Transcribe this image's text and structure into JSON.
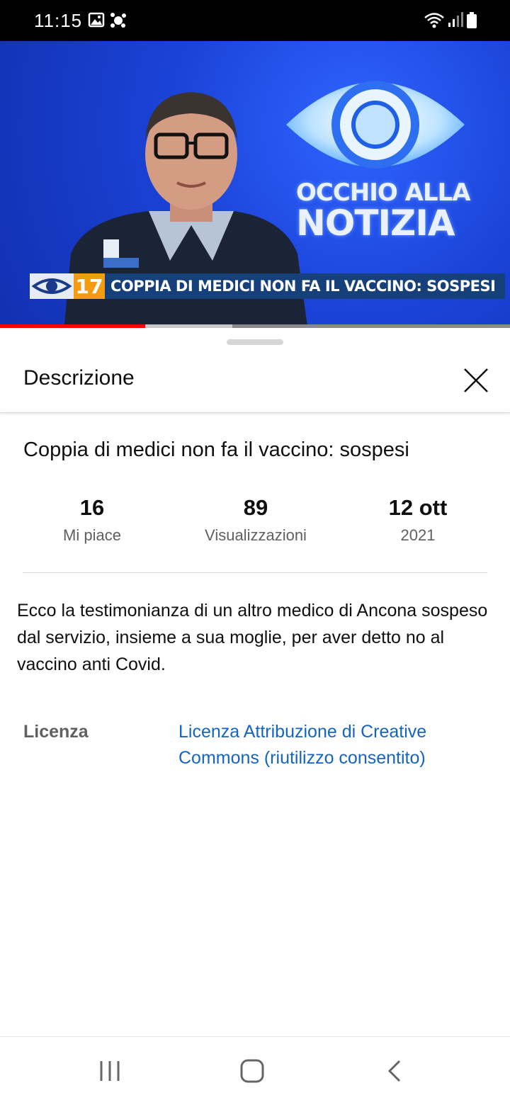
{
  "status_bar": {
    "time": "11:15",
    "icons": [
      "gallery-icon",
      "app-notification-icon",
      "wifi-icon",
      "signal-icon",
      "battery-icon"
    ]
  },
  "video": {
    "show_title_line1": "OCCHIO ALLA",
    "show_title_line2": "NOTIZIA",
    "channel_number": "17",
    "headline": "COPPIA DI MEDICI NON FA IL VACCINO: SOSPESI",
    "progress_played": 0.285,
    "progress_buffered": 0.455,
    "progress_color": "#ff0000"
  },
  "sheet": {
    "title": "Descrizione",
    "video_title": "Coppia di medici non fa il vaccino: sospesi",
    "stats": {
      "likes_value": "16",
      "likes_label": "Mi piace",
      "views_value": "89",
      "views_label": "Visualizzazioni",
      "date_value": "12 ott",
      "date_label": "2021"
    },
    "description": "Ecco la testimonianza di un altro medico di Ancona sospeso dal servizio, insieme a sua moglie, per aver detto no al vaccino anti Covid.",
    "license_label": "Licenza",
    "license_value": "Licenza Attribuzione di Creative Commons (riutilizzo consentito)",
    "link_color": "#1565c0"
  },
  "nav_bar": {
    "buttons": [
      "recents-icon",
      "home-icon",
      "back-icon"
    ]
  }
}
